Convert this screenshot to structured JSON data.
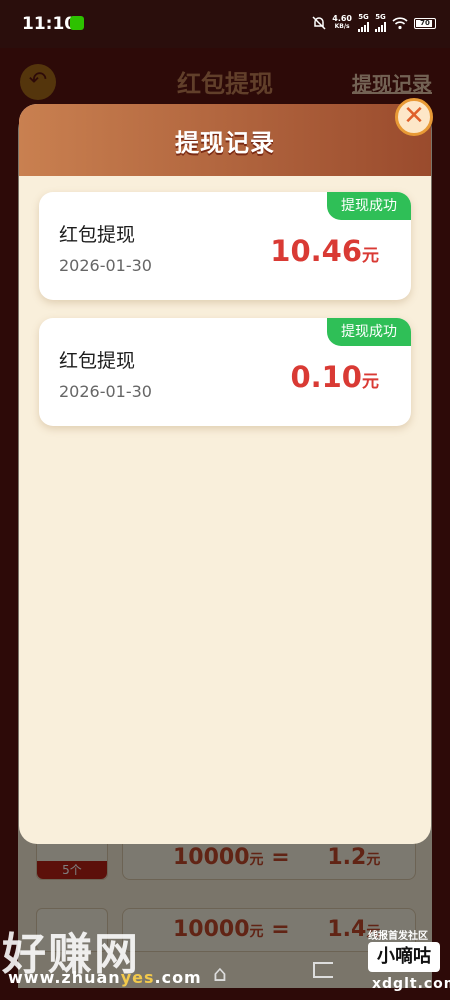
{
  "status_bar": {
    "time": "11:10",
    "net_speed_value": "4.60",
    "net_speed_unit": "KB/s",
    "signal1_label": "5G",
    "signal2_label": "5G",
    "battery": "70",
    "icons": [
      "wechat-icon",
      "bell-muted-icon",
      "wifi-icon",
      "battery-icon"
    ]
  },
  "page": {
    "back_icon": "back-arrow-icon",
    "title": "红包提现",
    "records_link": "提现记录",
    "rows": [
      {
        "count": "5个",
        "coins": "10000",
        "coin_unit": "元",
        "equals": "=",
        "cash": "1.2",
        "cash_unit": "元"
      },
      {
        "coins": "10000",
        "coin_unit": "元",
        "equals": "=",
        "cash": "1.4",
        "cash_unit": "元"
      }
    ]
  },
  "modal": {
    "title": "提现记录",
    "close_icon": "close-icon",
    "records": [
      {
        "name": "红包提现",
        "date": "2026-01-30",
        "amount": "10.46",
        "unit": "元",
        "status": "提现成功"
      },
      {
        "name": "红包提现",
        "date": "2026-01-30",
        "amount": "0.10",
        "unit": "元",
        "status": "提现成功"
      }
    ]
  },
  "watermarks": {
    "left_big": "好赚网",
    "left_url_a": "www.zhuan",
    "left_url_hl": "yes",
    "left_url_b": ".com",
    "right_top": "线报首发社区",
    "right_box": "小嘀咕",
    "right_url": "xdglt.com"
  },
  "colors": {
    "accent_red": "#d93a34",
    "success_green": "#2fbf57",
    "modal_bg": "#f9efdb"
  }
}
